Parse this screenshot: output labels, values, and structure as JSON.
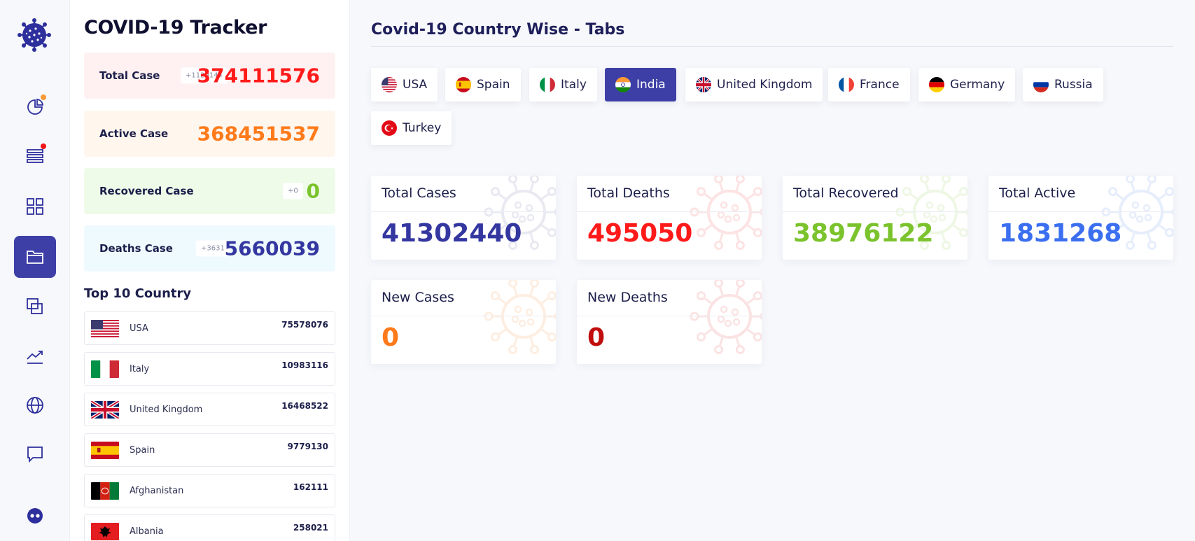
{
  "app": {
    "title": "COVID-19 Tracker",
    "main_title": "Covid-19 Country Wise - Tabs"
  },
  "rail": {
    "items": [
      "pie-chart-icon",
      "list-icon",
      "grid-icon",
      "folder-icon",
      "layers-icon",
      "trend-icon",
      "globe-icon",
      "chat-icon",
      "user-icon"
    ],
    "active_index": 3
  },
  "summary": {
    "total": {
      "label": "Total Case",
      "badge": "+1129144",
      "value": "374111576",
      "color": "#ff1a1a",
      "bg": "#fff1f1"
    },
    "active": {
      "label": "Active Case",
      "value": "368451537",
      "color": "#ff7a1a",
      "bg": "#fff6ee"
    },
    "recovered": {
      "label": "Recovered Case",
      "badge": "+0",
      "value": "0",
      "color": "#7bc32c",
      "bg": "#eefbe9"
    },
    "deaths": {
      "label": "Deaths Case",
      "badge": "+3631",
      "value": "5660039",
      "color": "#3437a0",
      "bg": "#effaff"
    }
  },
  "top_countries": {
    "title": "Top 10 Country",
    "items": [
      {
        "name": "USA",
        "value": "75578076",
        "flag": "us"
      },
      {
        "name": "Italy",
        "value": "10983116",
        "flag": "it"
      },
      {
        "name": "United Kingdom",
        "value": "16468522",
        "flag": "gb"
      },
      {
        "name": "Spain",
        "value": "9779130",
        "flag": "es"
      },
      {
        "name": "Afghanistan",
        "value": "162111",
        "flag": "af"
      },
      {
        "name": "Albania",
        "value": "258021",
        "flag": "al"
      }
    ]
  },
  "tabs": [
    {
      "label": "USA",
      "flag": "us"
    },
    {
      "label": "Spain",
      "flag": "es"
    },
    {
      "label": "Italy",
      "flag": "it"
    },
    {
      "label": "India",
      "flag": "in"
    },
    {
      "label": "United Kingdom",
      "flag": "gb"
    },
    {
      "label": "France",
      "flag": "fr"
    },
    {
      "label": "Germany",
      "flag": "de"
    },
    {
      "label": "Russia",
      "flag": "ru"
    },
    {
      "label": "Turkey",
      "flag": "tr"
    }
  ],
  "active_tab": "India",
  "cards": [
    {
      "title": "Total Cases",
      "value": "41302440",
      "color": "#3437a0",
      "virus": "#e9e9f2"
    },
    {
      "title": "Total Deaths",
      "value": "495050",
      "color": "#ff1a1a",
      "virus": "#fde3e3"
    },
    {
      "title": "Total Recovered",
      "value": "38976122",
      "color": "#7bc32c",
      "virus": "#eef7e4"
    },
    {
      "title": "Total Active",
      "value": "1831268",
      "color": "#3b6ff0",
      "virus": "#e6edfb"
    },
    {
      "title": "New Cases",
      "value": "0",
      "color": "#ff7a1a",
      "virus": "#fdeee1"
    },
    {
      "title": "New Deaths",
      "value": "0",
      "color": "#c00e0e",
      "virus": "#fbe3e3"
    }
  ]
}
